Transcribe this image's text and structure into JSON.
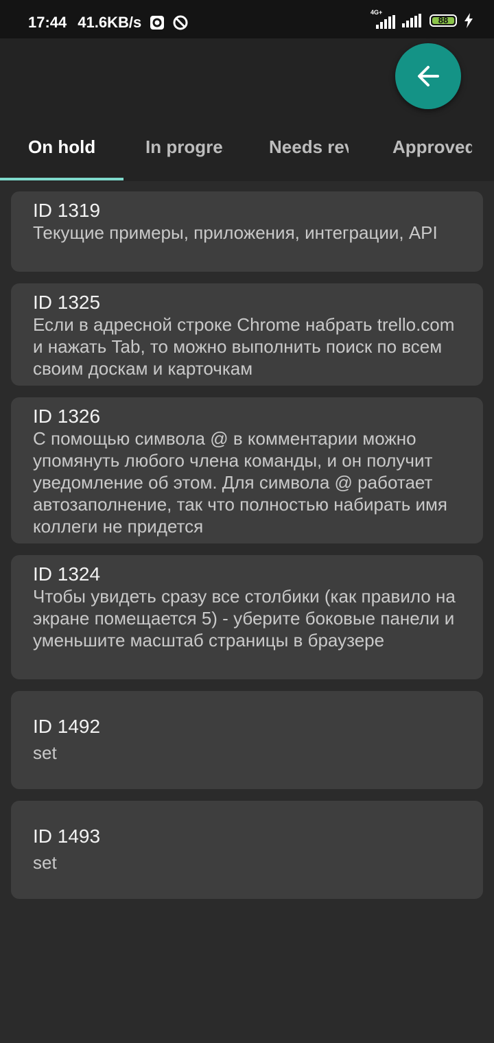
{
  "status_bar": {
    "time": "17:44",
    "net_speed": "41.6KB/s",
    "network_label": "4G+",
    "battery": "88"
  },
  "tabs": [
    {
      "label": "On hold",
      "active": true
    },
    {
      "label": "In progress",
      "active": false
    },
    {
      "label": "Needs review",
      "active": false
    },
    {
      "label": "Approved",
      "active": false
    }
  ],
  "cards": [
    {
      "id": "ID 1319",
      "text": "Текущие примеры, приложения, интеграции, API"
    },
    {
      "id": "ID 1325",
      "text": "Если в адресной строке Chrome набрать trello.com и нажать Tab, то можно выполнить поиск по всем своим доскам и карточкам"
    },
    {
      "id": "ID 1326",
      "text": "С помощью символа @ в комментарии можно упомянуть любого члена команды, и он получит уведомление об этом. Для символа @ работает автозаполнение, так что полностью набирать имя коллеги не придется"
    },
    {
      "id": "ID 1324",
      "text": "Чтобы увидеть сразу все столбики (как правило на экране помещается 5) - уберите боковые панели и уменьшите масштаб страницы в браузере"
    },
    {
      "id": "ID 1492",
      "text": "set"
    },
    {
      "id": "ID 1493",
      "text": "set"
    }
  ],
  "colors": {
    "accent": "#149386",
    "tab_indicator": "#7fd9cc",
    "card_bg": "#3e3e3e",
    "page_bg": "#2b2b2b"
  },
  "icons": {
    "fab": "arrow-left-icon"
  }
}
